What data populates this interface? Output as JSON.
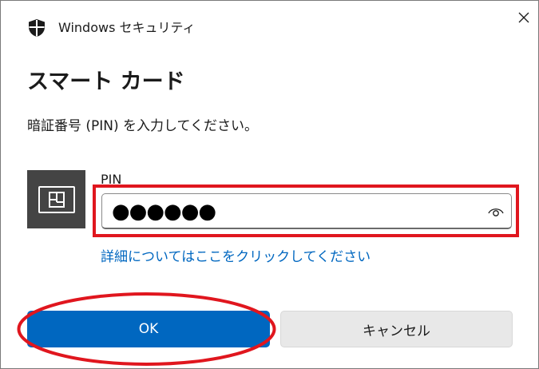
{
  "window": {
    "title": "Windows セキュリティ"
  },
  "dialog": {
    "heading": "スマート カード",
    "instruction": "暗証番号 (PIN) を入力してください。"
  },
  "pin_field": {
    "label": "PIN",
    "value": "●●●●●●"
  },
  "more_info_link": "詳細についてはここをクリックしてください",
  "buttons": {
    "ok": "OK",
    "cancel": "キャンセル"
  },
  "icons": {
    "title": "shield-icon",
    "close": "close-icon",
    "card": "smart-card-icon",
    "reveal": "eye-icon"
  },
  "colors": {
    "accent": "#0067c0",
    "annotation": "#e0161e",
    "card_tile": "#444444"
  }
}
